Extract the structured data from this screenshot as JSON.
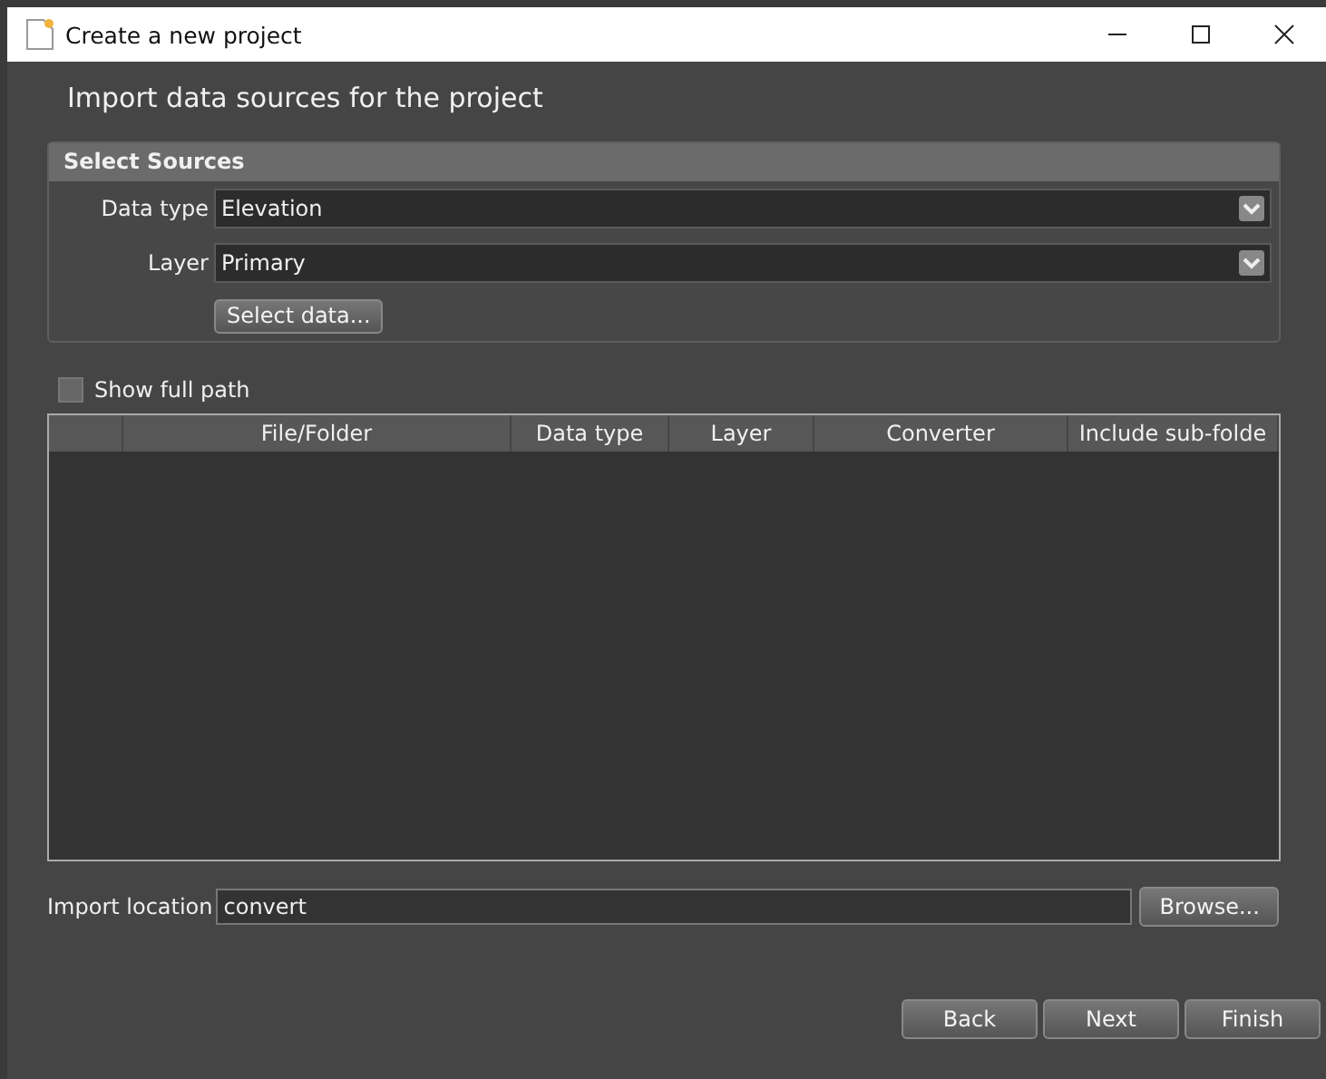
{
  "window": {
    "title": "Create a new project"
  },
  "heading": "Import data sources for the project",
  "select_sources": {
    "title": "Select Sources",
    "fields": [
      {
        "label": "Data type",
        "value": "Elevation"
      },
      {
        "label": "Layer",
        "value": "Primary"
      }
    ],
    "button": "Select data..."
  },
  "show_full_path": {
    "label": "Show full path",
    "checked": false
  },
  "table": {
    "columns": [
      "File/Folder",
      "Data type",
      "Layer",
      "Converter",
      "Include sub-folde"
    ]
  },
  "import_location": {
    "label": "Import location",
    "value": "convert",
    "button": "Browse..."
  },
  "buttons": [
    "Back",
    "Next",
    "Finish"
  ]
}
